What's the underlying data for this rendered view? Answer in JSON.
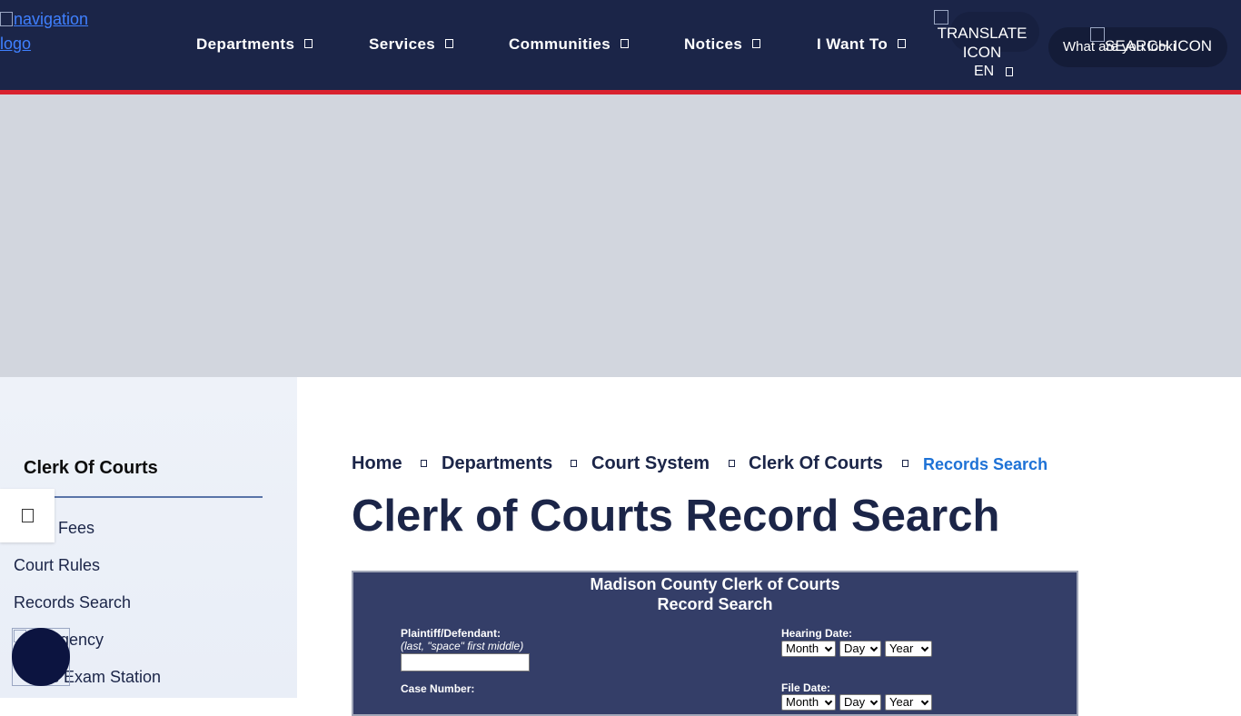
{
  "header": {
    "logo_alt": "navigation logo",
    "nav": [
      {
        "label": "Departments"
      },
      {
        "label": "Services"
      },
      {
        "label": "Communities"
      },
      {
        "label": "Notices"
      },
      {
        "label": "I Want To"
      }
    ],
    "translate_alt": "TRANSLATE ICON",
    "language": "EN",
    "search_placeholder": "What are you looki",
    "search_icon_alt": "SEARCH ICON"
  },
  "sidebar": {
    "title": "Clerk Of Courts",
    "items": [
      {
        "label": "Fees"
      },
      {
        "label": "Court Rules"
      },
      {
        "label": "Records Search"
      },
      {
        "label": "gency"
      },
      {
        "label": "s Exam Station"
      }
    ]
  },
  "breadcrumb": [
    "Home",
    "Departments",
    "Court System",
    "Clerk Of Courts",
    "Records Search"
  ],
  "page_title": "Clerk of Courts Record Search",
  "form": {
    "title_line1": "Madison County Clerk of Courts",
    "title_line2": "Record Search",
    "plaintiff_label": "Plaintiff/Defendant:",
    "plaintiff_hint": "(last, \"space\" first middle)",
    "case_label": "Case Number:",
    "hearing_label": "Hearing Date:",
    "file_label": "File Date:",
    "month": "Month",
    "day": "Day",
    "year": "Year"
  },
  "colors": {
    "header_bg": "#1b2548",
    "accent_red": "#d9222f",
    "link_blue": "#1e72d6",
    "form_bg": "#343e68"
  }
}
